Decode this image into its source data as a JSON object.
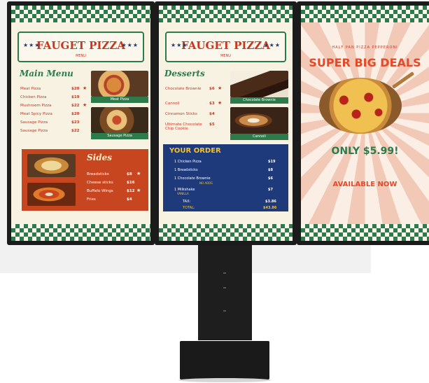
{
  "left_panel": {
    "header_title": "FAUGET PIZZA",
    "header_sub": "MENU",
    "section_title": "Main Menu",
    "items": [
      {
        "name": "Meat Pizza",
        "price": "$20"
      },
      {
        "name": "Chicken Pizza",
        "price": "$19"
      },
      {
        "name": "Mushroom Pizza",
        "price": "$22"
      },
      {
        "name": "Meat Spicy Pizza",
        "price": "$20"
      },
      {
        "name": "Sausage Pizza",
        "price": "$23"
      },
      {
        "name": "Sausage Pizza",
        "price": "$22"
      }
    ],
    "photo1_caption": "Meat Pizza",
    "photo2_caption": "Sausage Pizza",
    "sides_title": "Sides",
    "sides": [
      {
        "name": "Breadsticks",
        "price": "$8"
      },
      {
        "name": "Cheese sticks",
        "price": "$16"
      },
      {
        "name": "Buffalo Wings",
        "price": "$12"
      },
      {
        "name": "Fries",
        "price": "$4"
      }
    ]
  },
  "middle_panel": {
    "header_title": "FAUGET PIZZA",
    "header_sub": "MENU",
    "section_title": "Desserts",
    "items": [
      {
        "name": "Chocolate Brownie",
        "price": "$6"
      },
      {
        "name": "Cannoli",
        "price": "$3"
      },
      {
        "name": "Cinnamon Sticks",
        "price": "$4"
      },
      {
        "name": "Ultimate Chocolate Chip Cookie",
        "price": "$5"
      }
    ],
    "photo1_caption": "Chocolate Brownie",
    "photo2_caption": "Cannoli",
    "order_title": "YOUR ORDER",
    "order_items": [
      {
        "name": "1 Chicken Pizza",
        "price": "$19"
      },
      {
        "name": "1 Breadsticks",
        "price": "$8"
      },
      {
        "name": "1 Chocolate Brownie",
        "price": "$6",
        "note": "NO ADDS"
      },
      {
        "name": "1 Milkshake",
        "price": "$7",
        "note": "VANILLA"
      }
    ],
    "tax_label": "TAX:",
    "tax_value": "$3.86",
    "total_label": "TOTAL:",
    "total_value": "$43.86"
  },
  "right_panel": {
    "tagline": "HALF PAN PIZZA PEPPERONI",
    "headline": "SUPER BIG DEALS",
    "price_text": "ONLY $5.99!",
    "availability": "AVAILABLE NOW"
  },
  "colors": {
    "green": "#2d7a4a",
    "red": "#c8361f",
    "navy": "#1f3a7a",
    "cream": "#f8f2e3"
  }
}
